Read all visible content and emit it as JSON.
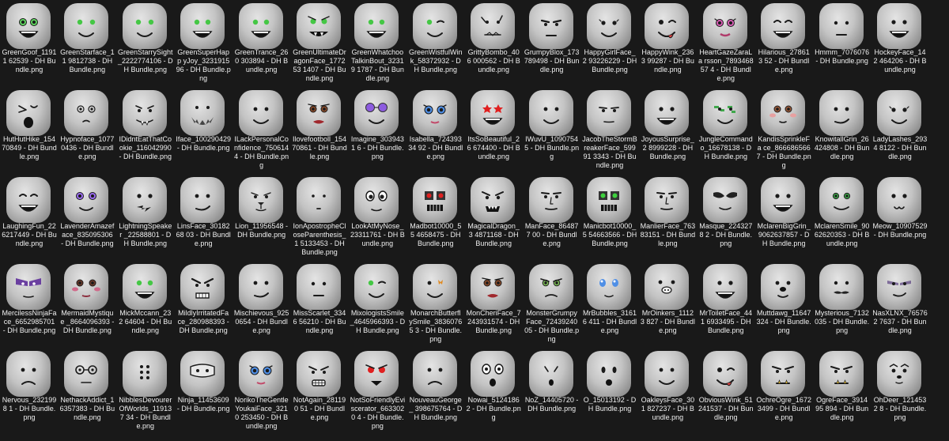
{
  "colors": {
    "background": "#191919",
    "text": "#f0f0f0",
    "head": "#c4c4c4"
  },
  "files": [
    {
      "name": "GreenGoof_11911 62539 - DH Bundle.png",
      "face": "smile-green"
    },
    {
      "name": "GreenStarface_11 9812738 - DH Bundle.png",
      "face": "green-star"
    },
    {
      "name": "GreenStarrySight _2222774106 - DH Bundle.png",
      "face": "green-star"
    },
    {
      "name": "GreenSuperHapp yJoy_323191596 - DH Bundle.png",
      "face": "green-grin"
    },
    {
      "name": "GreenTrance_260 303894 - DH Bundle.png",
      "face": "green-grin"
    },
    {
      "name": "GreenUltimateDr agonFace_177253 1407 - DH Bundle.png",
      "face": "green-fangs"
    },
    {
      "name": "GreenWhatchoo TalkinBout_32319 1787 - DH Bundle.png",
      "face": "green-grin"
    },
    {
      "name": "GreenWistfulWin k_58372932 - DH Bundle.png",
      "face": "wink-green"
    },
    {
      "name": "GrittyBombo_406 000562 - DH Bundle.png",
      "face": "gritty"
    },
    {
      "name": "GrumpyBlox_173 789498 - DH Bundle.png",
      "face": "grumpy"
    },
    {
      "name": "HappyGirlFace_2 93226229 - DH Bundle.png",
      "face": "lashes-smile"
    },
    {
      "name": "HappyWink_2363 99287 - DH Bundle.png",
      "face": "wink"
    },
    {
      "name": "HeartGazeZaraLa rsson_789346857 4 - DH Bundle.png",
      "face": "pink-eyes"
    },
    {
      "name": "Hilarious_278613 52 - DH Bundle.png",
      "face": "laugh"
    },
    {
      "name": "Hmmm_7076076 - DH Bundle.png",
      "face": "flat"
    },
    {
      "name": "HockeyFace_142 464206 - DH Bundle.png",
      "face": "grin"
    },
    {
      "name": "HutHutHike_154 70849 - DH Bundle.png",
      "face": "shout"
    },
    {
      "name": "Hypnoface_1077 0436 - DH Bundle.png",
      "face": "hypno"
    },
    {
      "name": "IDidntEatThatCo okie_116042990 - DH Bundle.png",
      "face": "fangs"
    },
    {
      "name": "Iface_100290429 - DH Bundle.png",
      "face": "beard"
    },
    {
      "name": "ILackPersonalCo nfidence_750614 4 - DH Bundle.png",
      "face": "smile"
    },
    {
      "name": "Ilovefootboll_154 70861 - DH Bundle.png",
      "face": "makeup"
    },
    {
      "name": "Imagine_3039431 6 - DH Bundle.png",
      "face": "purple-glasses"
    },
    {
      "name": "Isabella_72439334 92 - DH Bundle.png",
      "face": "blue-eyes"
    },
    {
      "name": "ItsSoBeautiful_26 674400 - DH Bundle.png",
      "face": "red-star"
    },
    {
      "name": "IWuvU_10907545 - DH Bundle.png",
      "face": "smile"
    },
    {
      "name": "JacobTheStormB reakerFace_59991 3343 - DH Bundle.png",
      "face": "stern"
    },
    {
      "name": "JoyousSurprise_2 8999228 - DH Bundle.png",
      "face": "grin"
    },
    {
      "name": "JungleCommand o_16678138 - DH Bundle.png",
      "face": "camo"
    },
    {
      "name": "KandisSprinkleFa ce_8666865667 - DH Bundle.png",
      "face": "blush"
    },
    {
      "name": "KnowitallGrin_26 424808 - DH Bundle.png",
      "face": "smirk"
    },
    {
      "name": "LadyLashes_2934 8122 - DH Bundle.png",
      "face": "lashes-smile"
    },
    {
      "name": "LaughingFun_22 6217449 - DH Bundle.png",
      "face": "laugh"
    },
    {
      "name": "LavenderAmazef ace_835095306 - DH Bundle.png",
      "face": "purple-eyes"
    },
    {
      "name": "LightningSpeaker _22588801 - DH Bundle.png",
      "face": "bolt"
    },
    {
      "name": "LinsFace_3018268 03 - DH Bundle.png",
      "face": "smirk"
    },
    {
      "name": "Lion_11956548 - DH Bundle.png",
      "face": "lion"
    },
    {
      "name": "IonApostropheCl oseParenthesis_1 5133453 - DH Bundle.png",
      "face": "dot"
    },
    {
      "name": "LookAtMyNose_ 23311761 - DH Bundle.png",
      "face": "big-eyes"
    },
    {
      "name": "Madbot10000_55 4658475 - DH Bundle.png",
      "face": "robot-red"
    },
    {
      "name": "MagicalDragon_3 4871168 - DH Bundle.png",
      "face": "dragon"
    },
    {
      "name": "ManFace_864877 00 - DH Bundle.png",
      "face": "man"
    },
    {
      "name": "Manicbot10000_5 54663566 - DH Bundle.png",
      "face": "robot-green"
    },
    {
      "name": "ManlierFace_763 83151 - DH Bundle.png",
      "face": "man"
    },
    {
      "name": "Masque_2243278 2 - DH Bundle.png",
      "face": "masque"
    },
    {
      "name": "MclarenBigGrin_ 9062637857 - DH Bundle.png",
      "face": "grin"
    },
    {
      "name": "MclarenSmile_90 62620353 - DH Bundle.png",
      "face": "green-smile"
    },
    {
      "name": "Meow_10907529 - DH Bundle.png",
      "face": "meow"
    },
    {
      "name": "MercilessNinjaFa ce_6652985701 - DH Bundle.png",
      "face": "ninja"
    },
    {
      "name": "MermaidMystique _8664096393 - DH Bundle.png",
      "face": "mermaid"
    },
    {
      "name": "MickMccann_232 64604 - DH Bundle.png",
      "face": "green-grin"
    },
    {
      "name": "MildlyIrritatedFa ce_280988393 - DH Bundle.png",
      "face": "irritated"
    },
    {
      "name": "Mischievous_925 0654 - DH Bundle.png",
      "face": "smirk"
    },
    {
      "name": "MissScarlet_3346 56210 - DH Bundle.png",
      "face": "flat"
    },
    {
      "name": "MixologistsSmile _4645966393 - DH Bundle.png",
      "face": "wink-green"
    },
    {
      "name": "MonarchButterfl ySmile_38360765 3 - DH Bundle.png",
      "face": "butterfly"
    },
    {
      "name": "MonCheriFace_7 243931574 - DH Bundle.png",
      "face": "makeup"
    },
    {
      "name": "MonsterGrumpy Face_7243924005 - DH Bundle.png",
      "face": "monster"
    },
    {
      "name": "MrBubbles_31616 411 - DH Bundle.png",
      "face": "bubbles"
    },
    {
      "name": "MrOinkers_11123 827 - DH Bundle.png",
      "face": "pig"
    },
    {
      "name": "MrToiletFace_441 6933495 - DH Bundle.png",
      "face": "grin"
    },
    {
      "name": "Muttdawg_11647 324 - DH Bundle.png",
      "face": "dog"
    },
    {
      "name": "Mysterious_7132 035 - DH Bundle.png",
      "face": "mustache"
    },
    {
      "name": "NasXLNX_765762 7637 - DH Bundle.png",
      "face": "purple-smirk"
    },
    {
      "name": "Nervous_2321998 1 - DH Bundle.png",
      "face": "frown"
    },
    {
      "name": "NethackAddict_1 6357383 - DH Bundle.png",
      "face": "nerd"
    },
    {
      "name": "NibblesDevourer OfWorlds_119137 34 - DH Bundle.png",
      "face": "dots"
    },
    {
      "name": "Ninja_11453609 - DH Bundle.png",
      "face": "mask"
    },
    {
      "name": "NorikoTheGentle YoukaiFace_3210 253450 - DH Bundle.png",
      "face": "blue-eyes"
    },
    {
      "name": "NotAgain_281190 51 - DH Bundle.png",
      "face": "teeth"
    },
    {
      "name": "NotSoFriendlyEvi scerator_6633020 4 - DH Bundle.png",
      "face": "red-eyes"
    },
    {
      "name": "NouveauGeorge_ 398675764 - DH Bundle.png",
      "face": "frown"
    },
    {
      "name": "Nowai_51241862 - DH Bundle.png",
      "face": "nowai"
    },
    {
      "name": "NoZ_14405720 - DH Bundle.png",
      "face": "noz"
    },
    {
      "name": "O_15013192 - DH Bundle.png",
      "face": "o"
    },
    {
      "name": "OakleysFace_301 827237 - DH Bundle.png",
      "face": "smile"
    },
    {
      "name": "ObviousWink_51 241537 - DH Bundle.png",
      "face": "wink"
    },
    {
      "name": "OchreOgre_1672 3499 - DH Bundle.png",
      "face": "ogre"
    },
    {
      "name": "OgreFace_391495 894 - DH Bundle.png",
      "face": "ogre"
    },
    {
      "name": "OhDeer_1214532 8 - DH Bundle.png",
      "face": "deer"
    }
  ]
}
